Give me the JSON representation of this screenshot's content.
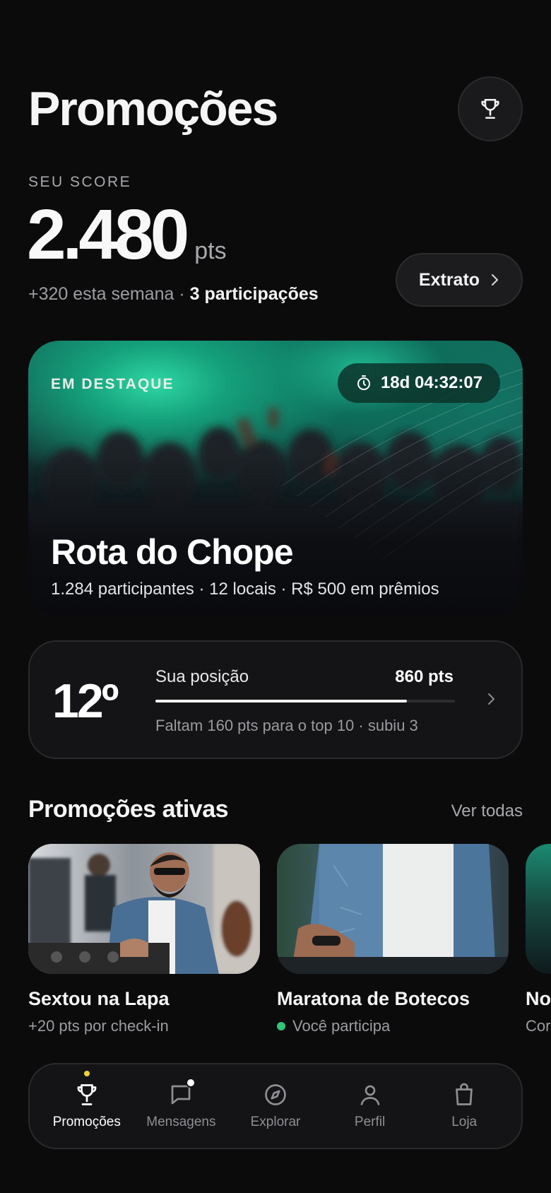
{
  "header": {
    "title": "Promoções",
    "trophy_icon": "trophy-icon"
  },
  "score": {
    "label": "SEU SCORE",
    "value": "2.480",
    "unit": "pts",
    "weekly": "+320 esta semana · ",
    "participations": "3 participações",
    "extrato_label": "Extrato"
  },
  "featured": {
    "tag": "EM DESTAQUE",
    "timer": "18d 04:32:07",
    "title": "Rota do Chope",
    "meta": "1.284 participantes · 12 locais · R$ 500 em prêmios"
  },
  "position": {
    "rank": "12º",
    "label": "Sua posição",
    "points": "860 pts",
    "progress": 0.84,
    "subtitle": "Faltam 160 pts para o top 10 · subiu 3"
  },
  "active_promos": {
    "title": "Promoções ativas",
    "see_all": "Ver todas",
    "items": [
      {
        "title": "Sextou na Lapa",
        "subtitle": "+20 pts por check-in"
      },
      {
        "title": "Maratona de Botecos",
        "subtitle": "Você participa",
        "status_color": "#33c27a"
      },
      {
        "title": "No",
        "subtitle": "Cor"
      }
    ]
  },
  "tabbar": {
    "items": [
      {
        "label": "Promoções",
        "icon": "trophy-icon",
        "active": true
      },
      {
        "label": "Mensagens",
        "icon": "chat-bubble-icon",
        "badge": true
      },
      {
        "label": "Explorar",
        "icon": "compass-icon"
      },
      {
        "label": "Perfil",
        "icon": "person-icon"
      },
      {
        "label": "Loja",
        "icon": "shopping-bag-icon"
      }
    ]
  },
  "colors": {
    "background": "#0b0b0c",
    "accent_green": "#33c27a",
    "teal": "#1fb790",
    "active_dot": "#f2d233"
  }
}
